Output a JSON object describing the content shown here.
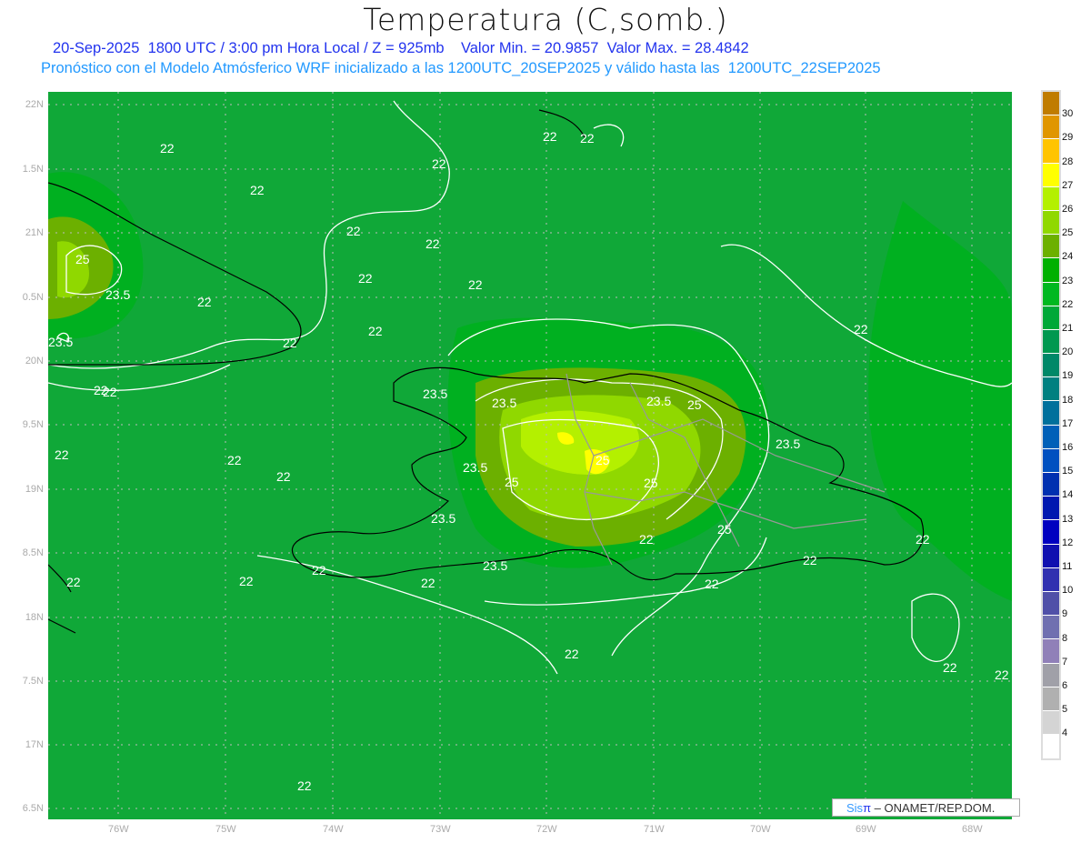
{
  "title": "Temperatura (C,somb.)",
  "subtitle_line1": "20-Sep-2025  1800 UTC / 3:00 pm Hora Local / Z = 925mb    Valor Min. = 20.9857  Valor Max. = 28.4842",
  "subtitle_line2": "Pronóstico con el Modelo Atmósferico WRF inicializado a las 1200UTC_20SEP2025 y válido hasta las  1200UTC_22SEP2025",
  "lat_labels": [
    "22N",
    "1.5N",
    "21N",
    "0.5N",
    "20N",
    "9.5N",
    "19N",
    "8.5N",
    "18N",
    "7.5N",
    "17N",
    "6.5N"
  ],
  "lon_labels": [
    "76W",
    "75W",
    "74W",
    "73W",
    "72W",
    "71W",
    "70W",
    "69W",
    "68W"
  ],
  "colorbar": {
    "labels": [
      "30",
      "29",
      "28",
      "27",
      "26",
      "25",
      "24",
      "23",
      "22",
      "21",
      "20",
      "19",
      "18",
      "17",
      "16",
      "15",
      "14",
      "13",
      "12",
      "11",
      "10",
      "9",
      "8",
      "7",
      "6",
      "5",
      "4"
    ],
    "colors": [
      "#c07c00",
      "#e09600",
      "#ffc400",
      "#ffff00",
      "#b4f000",
      "#90d800",
      "#6cb000",
      "#00b000",
      "#00b820",
      "#00a838",
      "#009850",
      "#008868",
      "#008080",
      "#00709c",
      "#0060b8",
      "#0050c0",
      "#0030b0",
      "#0018b0",
      "#0000c0",
      "#1010b0",
      "#3030b0",
      "#5050a8",
      "#7070b0",
      "#9080b8",
      "#a0a0a8",
      "#b0b0b0",
      "#d4d4d4",
      "#ffffff"
    ]
  },
  "contour_labels": [
    "22",
    "22",
    "22",
    "22",
    "22",
    "22",
    "22",
    "22",
    "22",
    "22",
    "22",
    "22",
    "22",
    "25",
    "23.5",
    "22",
    "23.5",
    "22",
    "22",
    "22",
    "23.5",
    "23.5",
    "25",
    "23.5",
    "25",
    "23.5",
    "25",
    "25",
    "25",
    "23.5",
    "22",
    "22",
    "23.5",
    "22",
    "22",
    "22",
    "22",
    "22",
    "22",
    "22",
    "22",
    "22",
    "22",
    "22",
    "23.5"
  ],
  "credit": {
    "sis": "Sis",
    "pi": "π",
    "text": " – ONAMET/REP.DOM."
  }
}
